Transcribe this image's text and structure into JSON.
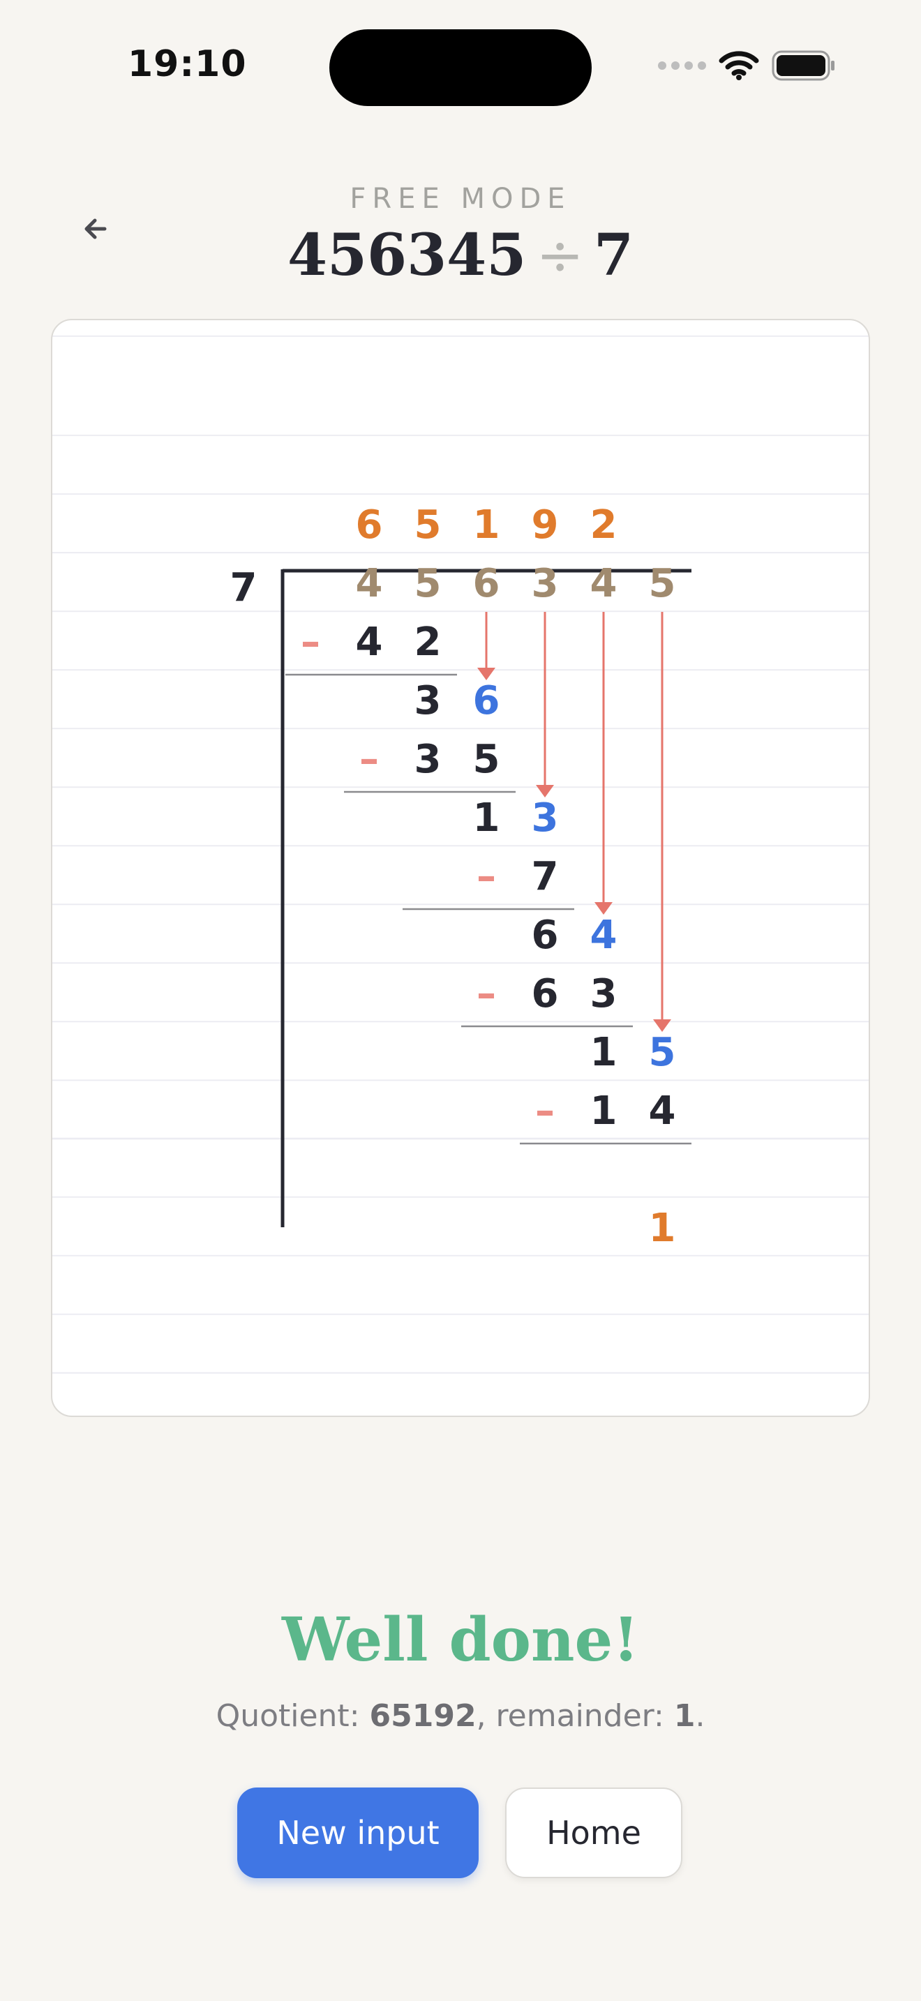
{
  "status_bar": {
    "time": "19:10"
  },
  "header": {
    "mode_label": "FREE MODE",
    "dividend": "456345",
    "operator": "÷",
    "divisor": "7"
  },
  "division": {
    "divisor": "7",
    "quotient_digits": [
      "6",
      "5",
      "1",
      "9",
      "2"
    ],
    "dividend_digits": [
      "4",
      "5",
      "6",
      "3",
      "4",
      "5"
    ],
    "steps": [
      {
        "minus": "–",
        "subtract": [
          "4",
          "2"
        ],
        "remainder_digit": "3",
        "brought_down": "6"
      },
      {
        "minus": "–",
        "subtract": [
          "3",
          "5"
        ],
        "remainder_digit": "1",
        "brought_down": "3"
      },
      {
        "minus": "–",
        "subtract": [
          "7"
        ],
        "remainder_digit": "6",
        "brought_down": "4"
      },
      {
        "minus": "–",
        "subtract": [
          "6",
          "3"
        ],
        "remainder_digit": "1",
        "brought_down": "5"
      },
      {
        "minus": "–",
        "subtract": [
          "1",
          "4"
        ]
      }
    ],
    "final_remainder": "1",
    "colors": {
      "quotient": "#e07b2c",
      "dividend": "#a08a6e",
      "brought_down": "#3d74de",
      "arrow": "#e5756b",
      "minus": "#ec8c84",
      "ink": "#262730"
    }
  },
  "result": {
    "title": "Well done!",
    "quotient_label": "Quotient: ",
    "quotient_value": "65192",
    "remainder_label": ", remainder: ",
    "remainder_value": "1",
    "end": "."
  },
  "buttons": {
    "new_input": "New input",
    "home": "Home"
  }
}
